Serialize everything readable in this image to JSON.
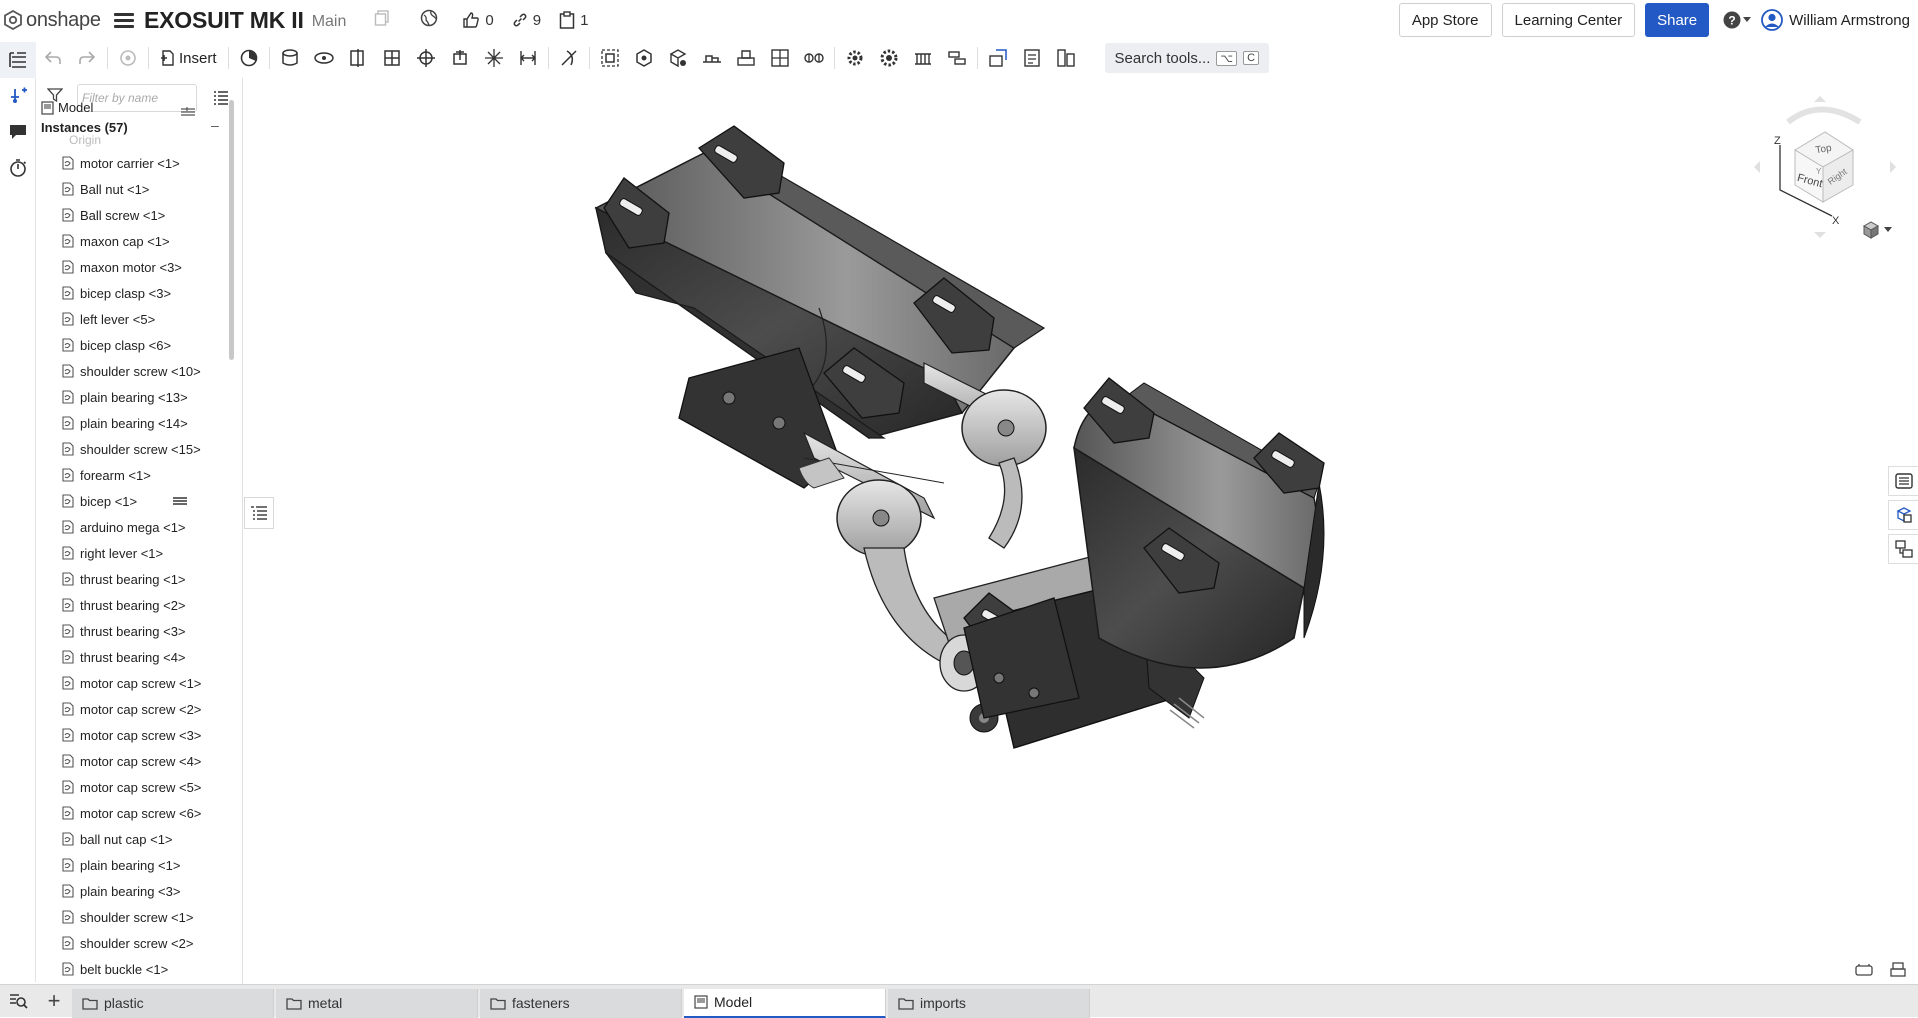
{
  "app": {
    "logo_text": "onshape",
    "doc_title": "EXOSUIT MK II",
    "branch": "Main",
    "likes": "0",
    "links": "9",
    "copies": "1"
  },
  "header": {
    "app_store": "App Store",
    "learning_center": "Learning Center",
    "share": "Share",
    "user_name": "William Armstrong"
  },
  "toolbar": {
    "insert_label": "Insert",
    "search_label": "Search tools...",
    "search_key1": "⌥",
    "search_key2": "C"
  },
  "panel": {
    "filter_placeholder": "Filter by name",
    "model_label": "Model",
    "instances_label": "Instances (57)",
    "origin_label": "Origin",
    "items": [
      "motor carrier <1>",
      "Ball nut <1>",
      "Ball screw <1>",
      "maxon cap <1>",
      "maxon motor <3>",
      "bicep clasp <3>",
      "left lever <5>",
      "bicep clasp <6>",
      "shoulder screw <10>",
      "plain bearing <13>",
      "plain bearing <14>",
      "shoulder screw <15>",
      "forearm <1>",
      "bicep <1>",
      "arduino mega <1>",
      "right lever <1>",
      "thrust bearing <1>",
      "thrust bearing <2>",
      "thrust bearing <3>",
      "thrust bearing <4>",
      "motor cap screw <1>",
      "motor cap screw <2>",
      "motor cap screw <3>",
      "motor cap screw <4>",
      "motor cap screw <5>",
      "motor cap screw <6>",
      "ball nut cap <1>",
      "plain bearing <1>",
      "plain bearing <3>",
      "shoulder screw <1>",
      "shoulder screw <2>",
      "belt buckle <1>"
    ]
  },
  "viewcube": {
    "top": "Top",
    "front": "Front",
    "right": "Right",
    "axis_z": "Z",
    "axis_x": "X",
    "axis_y": "Y"
  },
  "tabs": [
    {
      "label": "plastic"
    },
    {
      "label": "metal"
    },
    {
      "label": "fasteners"
    },
    {
      "label": "Model"
    },
    {
      "label": "imports"
    }
  ],
  "colors": {
    "accent": "#2359c4",
    "dark_part": "#3a3a3a",
    "light_part": "#c9c9c9"
  }
}
